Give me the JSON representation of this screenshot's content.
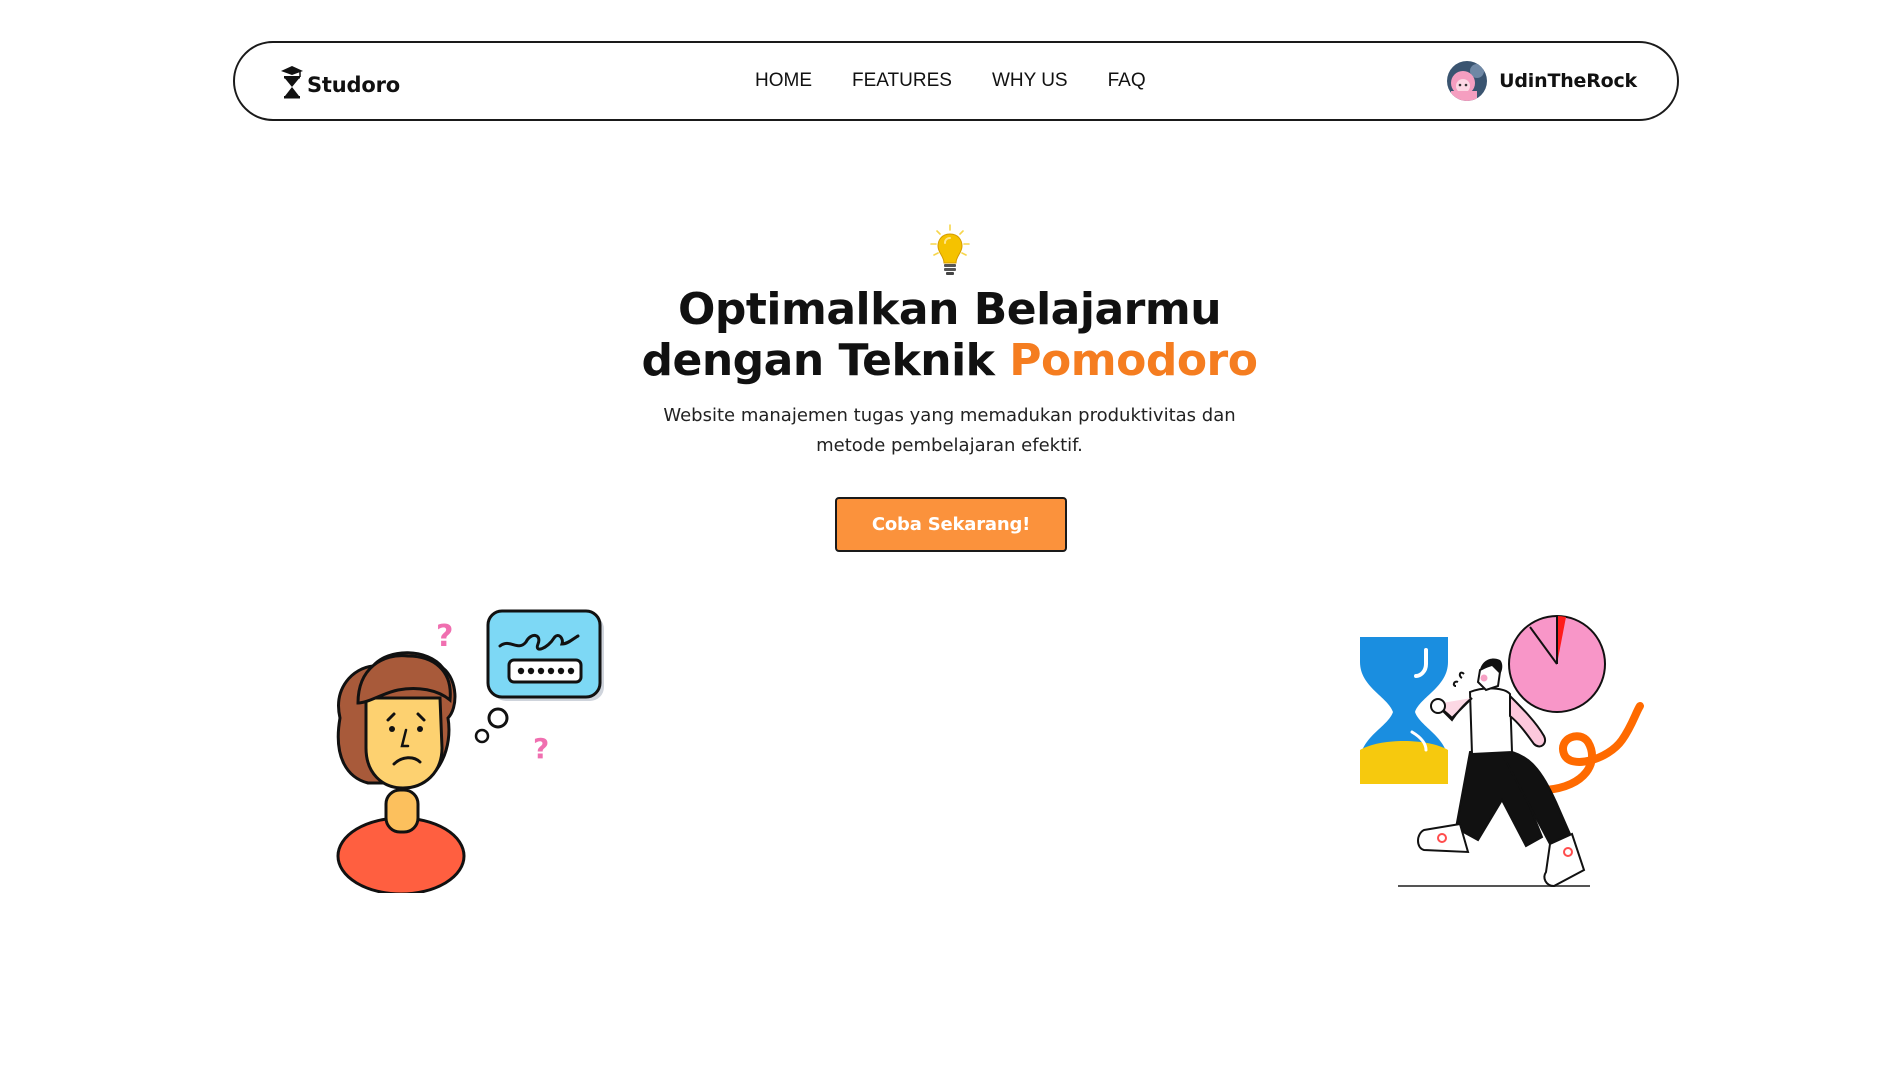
{
  "navbar": {
    "brand": "Studoro",
    "links": [
      "HOME",
      "FEATURES",
      "WHY US",
      "FAQ"
    ],
    "user_name": "UdinTheRock"
  },
  "hero": {
    "icon": "lightbulb-icon",
    "title_line1": "Optimalkan Belajarmu",
    "title_line2_prefix": "dengan Teknik ",
    "title_accent": "Pomodoro",
    "subtitle_line1": "Website manajemen tugas yang memadukan produktivitas dan",
    "subtitle_line2": "metode pembelajaran efektif.",
    "cta_label": "Coba Sekarang!"
  },
  "colors": {
    "accent": "#f57d20",
    "cta_background": "#fb923c",
    "border": "#1a1a1a"
  },
  "illustrations": {
    "left": "confused-person-password-illustration",
    "right": "person-running-hourglass-clock-illustration"
  }
}
